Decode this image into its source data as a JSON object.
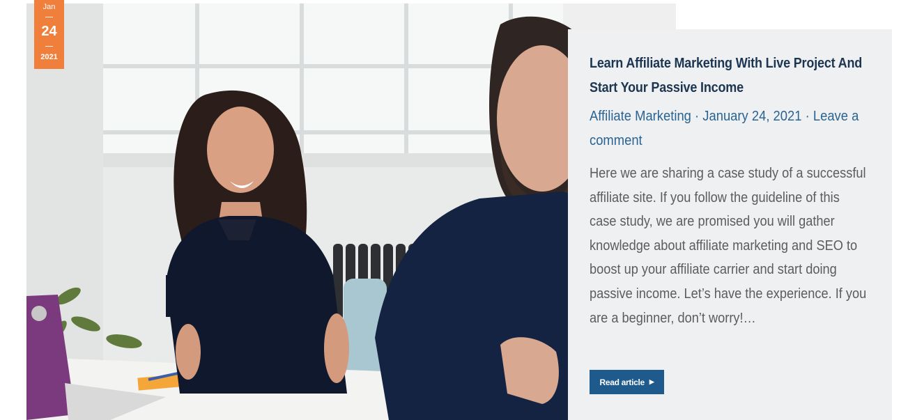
{
  "post": {
    "date": {
      "month": "Jan",
      "day": "24",
      "year": "2021"
    },
    "image": {
      "description_icon": "office-meeting-photo"
    },
    "title": "Learn Affiliate Marketing With Live Project And Start Your Passive Income",
    "meta": {
      "category": "Affiliate Marketing",
      "separator": "·",
      "date": "January 24, 2021",
      "comments": "Leave a comment"
    },
    "excerpt": "Here we are sharing a case study of a successful affiliate site. If you follow the guideline of this case study, we are promised you will gather knowledge about affiliate marketing and SEO to boost up your affiliate carrier and start doing passive income. Let’s have the experience. If you are a beginner, don’t worry!…",
    "read_more": {
      "label": "Read article",
      "icon": "caret-right-icon"
    }
  },
  "colors": {
    "badge": "#ef7f3a",
    "title": "#1c3550",
    "meta": "#2a6392",
    "button": "#1f5a8d",
    "panel": "#eff0f2"
  }
}
